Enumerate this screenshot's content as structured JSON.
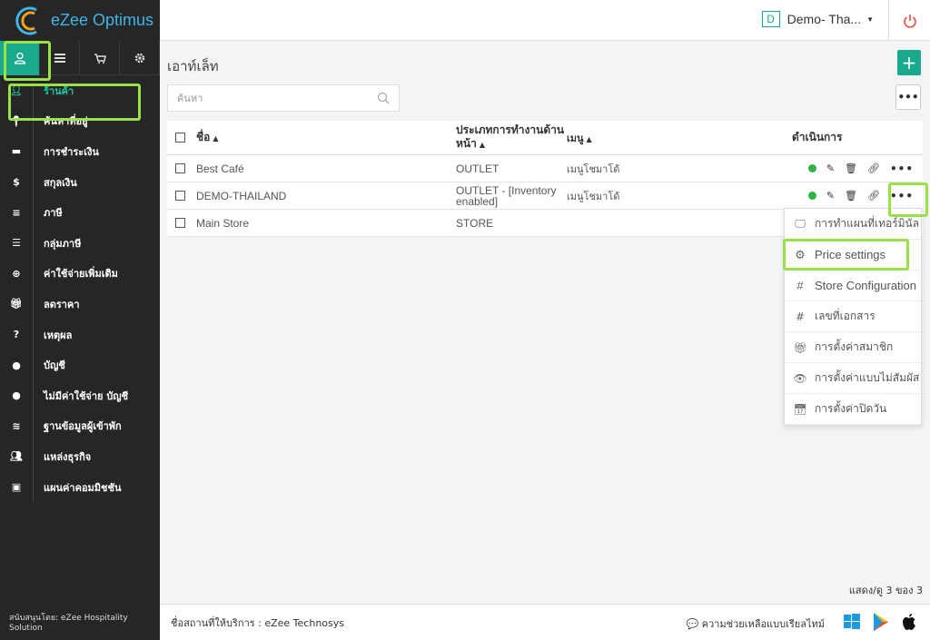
{
  "brand": {
    "name": "eZee Optimus"
  },
  "topbar": {
    "property_initial": "D",
    "property_name": "Demo- Tha..."
  },
  "sidebar": {
    "tabs": [
      {
        "icon": "user-icon",
        "active": true
      },
      {
        "icon": "list-icon",
        "active": false
      },
      {
        "icon": "cart-icon",
        "active": false
      },
      {
        "icon": "gear-icon",
        "active": false
      }
    ],
    "items": [
      {
        "label": "ร้านค้า",
        "icon": "user-icon",
        "active": true
      },
      {
        "label": "ค้นหาที่อยู่",
        "icon": "map-pin-icon"
      },
      {
        "label": "การชำระเงิน",
        "icon": "credit-card-icon"
      },
      {
        "label": "สกุลเงิน",
        "icon": "dollar-icon"
      },
      {
        "label": "ภาษี",
        "icon": "menu-icon"
      },
      {
        "label": "กลุ่มภาษี",
        "icon": "list-icon"
      },
      {
        "label": "ค่าใช้จ่ายเพิ่มเติม",
        "icon": "plus-circle-icon"
      },
      {
        "label": "ลดราคา",
        "icon": "gift-icon"
      },
      {
        "label": "เหตุผล",
        "icon": "question-circle-icon"
      },
      {
        "label": "บัญชี",
        "icon": "user-solid-icon"
      },
      {
        "label": "ไม่มีค่าใช้จ่าย บัญชี",
        "icon": "user-solid-icon"
      },
      {
        "label": "ฐานข้อมูลผู้เข้าพัก",
        "icon": "database-icon"
      },
      {
        "label": "แหล่งธุรกิจ",
        "icon": "users-icon"
      },
      {
        "label": "แผนค่าคอมมิชชัน",
        "icon": "money-icon"
      }
    ],
    "footer": "สนับสนุนโดย: eZee Hospitality Solution"
  },
  "main": {
    "title": "เอาท์เล็ท",
    "search_placeholder": "ค้นหา",
    "columns": {
      "name": "ชื่อ",
      "type": "ประเภทการทำงานด้านหน้า",
      "menu": "เมนู",
      "actions": "ดำเนินการ"
    },
    "rows": [
      {
        "name": "Best Café",
        "type": "OUTLET",
        "menu": "เมนูโชมาโด้",
        "has_actions": true
      },
      {
        "name": "DEMO-THAILAND",
        "type": "OUTLET - [Inventory enabled]",
        "menu": "เมนูโชมาโด้",
        "has_actions": true
      },
      {
        "name": "Main Store",
        "type": "STORE",
        "menu": "",
        "has_actions": false
      }
    ],
    "dropdown": [
      {
        "label": "การทำแผนที่เทอร์มินัล",
        "icon": "monitor-icon"
      },
      {
        "label": "Price settings",
        "icon": "gear-icon"
      },
      {
        "label": "Store Configuration",
        "icon": "hash-icon"
      },
      {
        "label": "เลขที่เอกสาร",
        "icon": "hash-icon"
      },
      {
        "label": "การตั้งค่าสมาชิก",
        "icon": "gift-icon"
      },
      {
        "label": "การตั้งค่าแบบไม่สัมผัส",
        "icon": "eye-icon"
      },
      {
        "label": "การตั้งค่าปิดวัน",
        "icon": "calendar-icon"
      }
    ],
    "records": "แสดง/ดู 3 ของ 3"
  },
  "footer": {
    "provider": "ชื่อสถานที่ให้บริการ : eZee Technosys",
    "help": "ความช่วยเหลือแบบเรียลไทม์"
  },
  "colors": {
    "accent": "#1aa98d",
    "sidebar": "#262626",
    "highlight": "#9be04a",
    "status": "#2fb345"
  }
}
